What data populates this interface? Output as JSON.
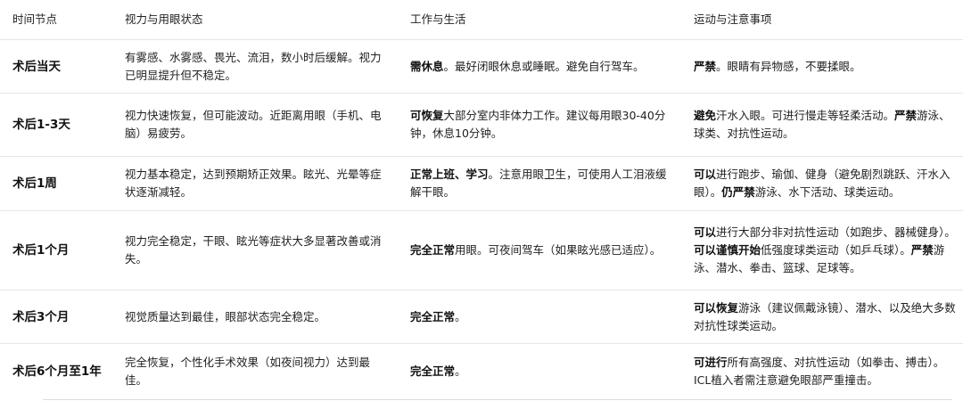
{
  "headers": {
    "stage": "时间节点",
    "vision": "视力与用眼状态",
    "work": "工作与生活",
    "sport": "运动与注意事项"
  },
  "rows": [
    {
      "stage": "术后当天",
      "vision": "有雾感、水雾感、畏光、流泪，数小时后缓解。视力已明显提升但不稳定。",
      "work_b1": "需休息",
      "work_t1": "。最好闭眼休息或睡眠。避免自行驾车。",
      "sport_b1": "严禁",
      "sport_t1": "。眼睛有异物感，不要揉眼。"
    },
    {
      "stage": "术后1-3天",
      "vision": "视力快速恢复，但可能波动。近距离用眼（手机、电脑）易疲劳。",
      "work_b1": "可恢复",
      "work_t1": "大部分室内非体力工作。建议每用眼30-40分钟，休息10分钟。",
      "sport_b1": "避免",
      "sport_t1": "汗水入眼。可进行慢走等轻柔活动。",
      "sport_b2": "严禁",
      "sport_t2": "游泳、球类、对抗性运动。"
    },
    {
      "stage": "术后1周",
      "vision": "视力基本稳定，达到预期矫正效果。眩光、光晕等症状逐渐减轻。",
      "work_b1": "正常上班、学习",
      "work_t1": "。注意用眼卫生，可使用人工泪液缓解干眼。",
      "sport_b1": "可以",
      "sport_t1": "进行跑步、瑜伽、健身（避免剧烈跳跃、汗水入眼）。",
      "sport_b2": "仍严禁",
      "sport_t2": "游泳、水下活动、球类运动。"
    },
    {
      "stage": "术后1个月",
      "vision": "视力完全稳定，干眼、眩光等症状大多显著改善或消失。",
      "work_b1": "完全正常",
      "work_t1": "用眼。可夜间驾车（如果眩光感已适应）。",
      "sport_b1": "可以",
      "sport_t1": "进行大部分非对抗性运动（如跑步、器械健身）。",
      "sport_b2": "可以谨慎开始",
      "sport_t2": "低强度球类运动（如乒乓球）。",
      "sport_b3": "严禁",
      "sport_t3": "游泳、潜水、拳击、篮球、足球等。"
    },
    {
      "stage": "术后3个月",
      "vision": "视觉质量达到最佳，眼部状态完全稳定。",
      "work_b1": "完全正常",
      "work_t1": "。",
      "sport_b1": "可以恢复",
      "sport_t1": "游泳（建议佩戴泳镜）、潜水、以及绝大多数对抗性球类运动。"
    },
    {
      "stage": "术后6个月至1年",
      "vision": "完全恢复，个性化手术效果（如夜间视力）达到最佳。",
      "work_b1": "完全正常",
      "work_t1": "。",
      "sport_b1": "可进行",
      "sport_t1": "所有高强度、对抗性运动（如拳击、搏击）。ICL植入者需注意避免眼部严重撞击。"
    }
  ]
}
